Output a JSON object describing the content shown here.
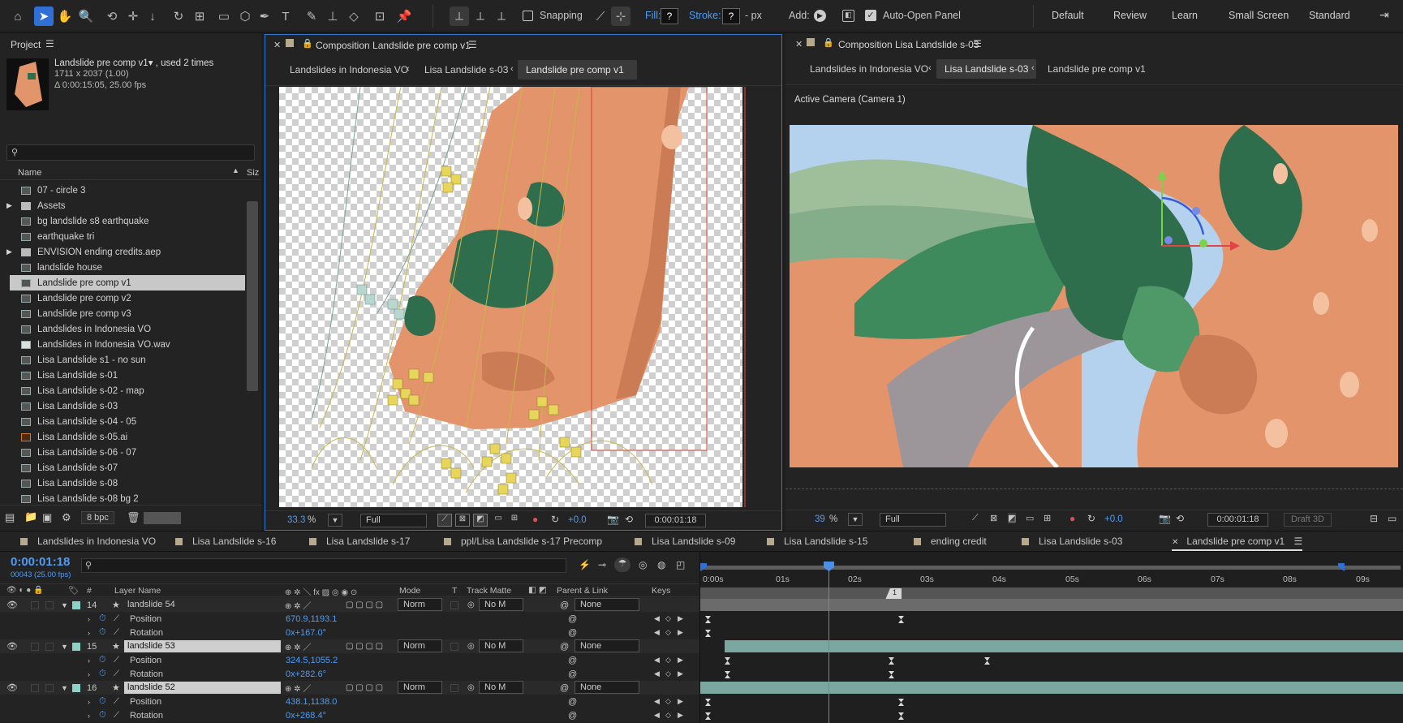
{
  "toolbar": {
    "snapping_label": "Snapping",
    "fill_label": "Fill:",
    "fill_value": "?",
    "stroke_label": "Stroke:",
    "stroke_value": "?",
    "stroke_unit": "- px",
    "add_label": "Add:",
    "auto_open_label": "Auto-Open Panel",
    "workspaces": [
      "Default",
      "Review",
      "Learn",
      "Small Screen",
      "Standard"
    ]
  },
  "project": {
    "title": "Project",
    "comp_name": "Landslide pre comp v1▾ , used 2 times",
    "comp_size": "1711 x 2037 (1.00)",
    "comp_duration": "Δ 0:00:15:05, 25.00 fps",
    "search_placeholder": "",
    "col_name": "Name",
    "col_size": "Siz",
    "items": [
      {
        "label": "07 - circle 3",
        "type": "comp"
      },
      {
        "label": "Assets",
        "type": "folder"
      },
      {
        "label": "bg landslide s8 earthquake",
        "type": "comp"
      },
      {
        "label": "earthquake tri",
        "type": "comp"
      },
      {
        "label": "ENVISION ending credits.aep",
        "type": "folder"
      },
      {
        "label": "landslide house",
        "type": "comp"
      },
      {
        "label": "Landslide pre comp v1",
        "type": "comp"
      },
      {
        "label": "Landslide pre comp v2",
        "type": "comp"
      },
      {
        "label": "Landslide pre comp v3",
        "type": "comp"
      },
      {
        "label": "Landslides in Indonesia VO",
        "type": "comp"
      },
      {
        "label": "Landslides in Indonesia VO.wav",
        "type": "audio"
      },
      {
        "label": "Lisa Landslide s1 - no sun",
        "type": "comp"
      },
      {
        "label": "Lisa Landslide s-01",
        "type": "comp"
      },
      {
        "label": "Lisa Landslide s-02 - map",
        "type": "comp"
      },
      {
        "label": "Lisa Landslide s-03",
        "type": "comp"
      },
      {
        "label": "Lisa Landslide s-04 - 05",
        "type": "comp"
      },
      {
        "label": "Lisa Landslide s-05.ai",
        "type": "ai"
      },
      {
        "label": "Lisa Landslide s-06 - 07",
        "type": "comp"
      },
      {
        "label": "Lisa Landslide s-07",
        "type": "comp"
      },
      {
        "label": "Lisa Landslide s-08",
        "type": "comp"
      },
      {
        "label": "Lisa Landslide s-08 bg 2",
        "type": "comp"
      }
    ],
    "bpc": "8 bpc"
  },
  "comp1": {
    "title": "Composition Landslide pre comp v1",
    "crumbs": [
      "Landslides in Indonesia VO",
      "Lisa Landslide s-03",
      "Landslide pre comp v1"
    ],
    "zoom": "33.3",
    "zoom_unit": "%",
    "resolution": "Full",
    "exposure": "+0.0",
    "timecode": "0:00:01:18"
  },
  "comp2": {
    "title": "Composition Lisa Landslide s-03",
    "crumbs": [
      "Landslides in Indonesia VO",
      "Lisa Landslide s-03",
      "Landslide pre comp v1"
    ],
    "camera": "Active Camera (Camera 1)",
    "zoom": "39",
    "zoom_unit": "%",
    "resolution": "Full",
    "exposure": "+0.0",
    "timecode": "0:00:01:18",
    "renderer": "Draft 3D"
  },
  "timeline": {
    "tabs": [
      "Landslides in Indonesia VO",
      "Lisa Landslide s-16",
      "Lisa Landslide s-17",
      "ppl/Lisa Landslide s-17 Precomp",
      "Lisa Landslide s-09",
      "Lisa Landslide s-15",
      "ending credit",
      "Lisa Landslide s-03",
      "Landslide pre comp v1"
    ],
    "timecode": "0:00:01:18",
    "frames": "00043 (25.00 fps)",
    "headers": {
      "num": "#",
      "layer": "Layer Name",
      "mode": "Mode",
      "t": "T",
      "matte": "Track Matte",
      "parent": "Parent & Link",
      "keys": "Keys"
    },
    "ruler": [
      "0:00s",
      "01s",
      "02s",
      "03s",
      "04s",
      "05s",
      "06s",
      "07s",
      "08s",
      "09s"
    ],
    "marker": "1",
    "layers": [
      {
        "num": "14",
        "name": "landslide 54",
        "mode": "Norm",
        "matte": "No M",
        "parent": "None",
        "position": "670.9,1193.1",
        "rotation": "0x+167.0°",
        "selected": false
      },
      {
        "num": "15",
        "name": "landslide 53",
        "mode": "Norm",
        "matte": "No M",
        "parent": "None",
        "position": "324.5,1055.2",
        "rotation": "0x+282.6°",
        "selected": true
      },
      {
        "num": "16",
        "name": "landslide 52",
        "mode": "Norm",
        "matte": "No M",
        "parent": "None",
        "position": "438.1,1138.0",
        "rotation": "0x+268.4°",
        "selected": true
      }
    ],
    "prop_position": "Position",
    "prop_rotation": "Rotation"
  }
}
